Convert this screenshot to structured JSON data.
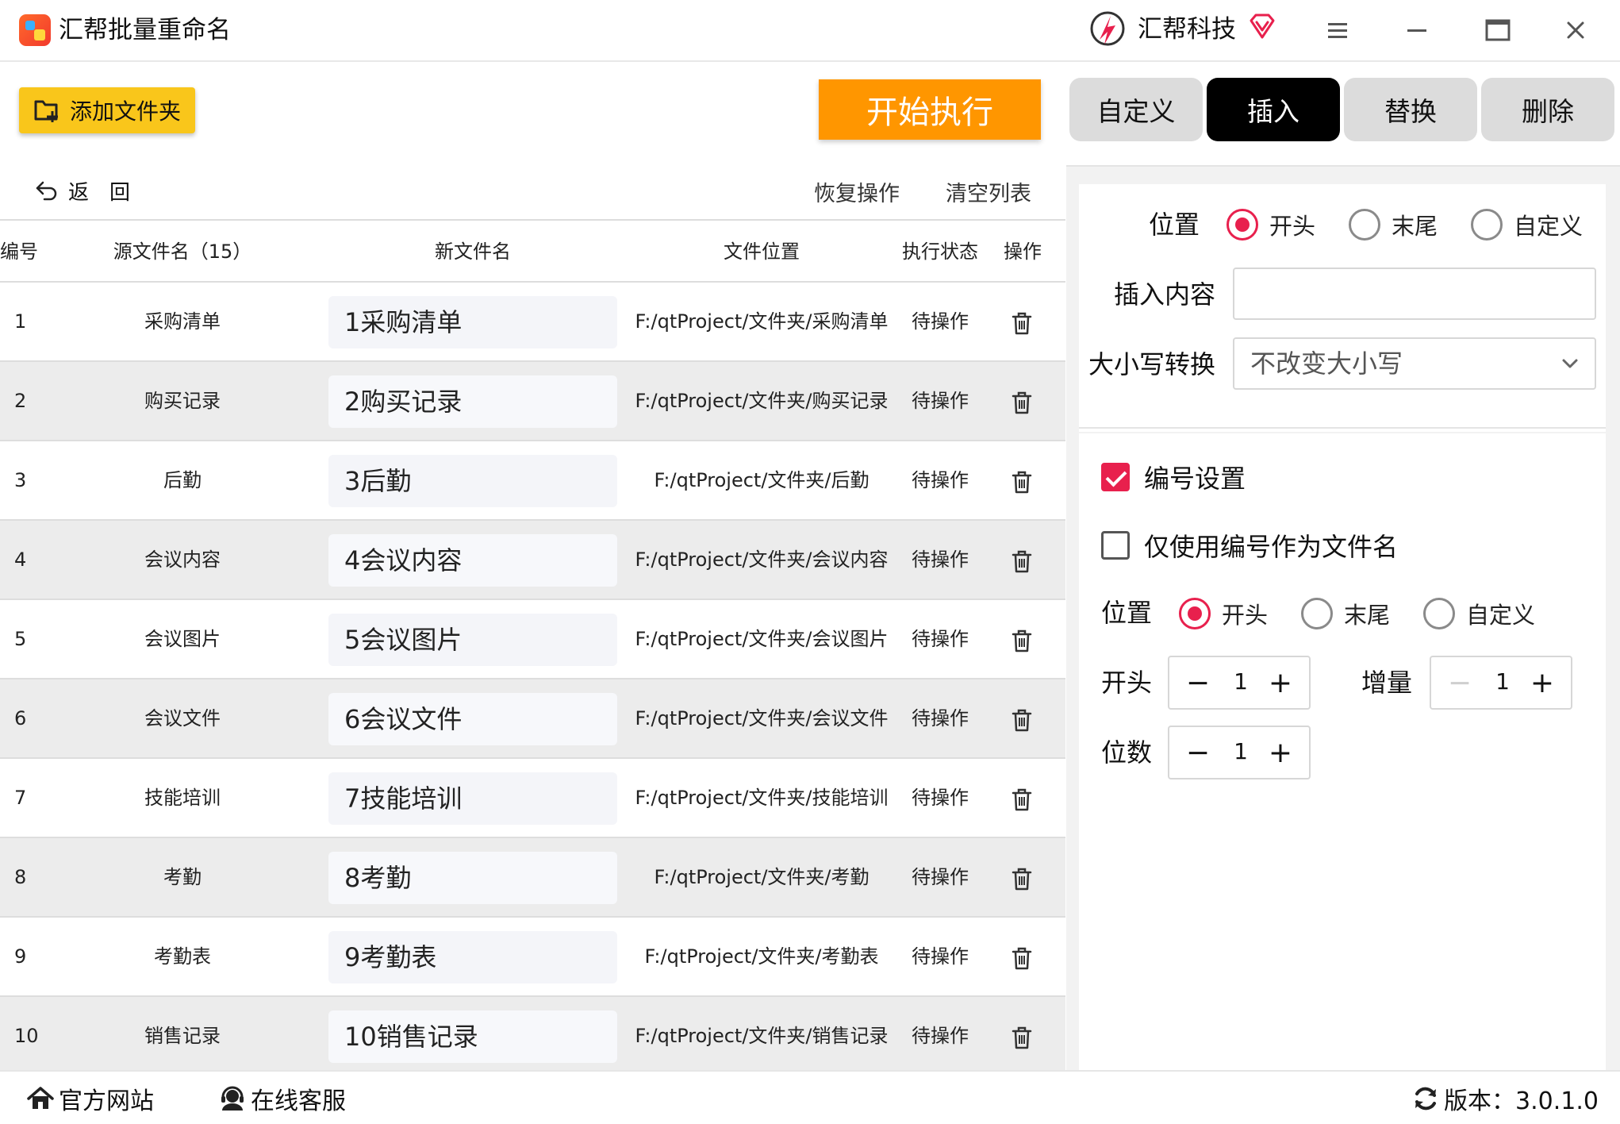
{
  "app": {
    "title": "汇帮批量重命名",
    "brand": "汇帮科技"
  },
  "toolbar": {
    "add_folder": "添加文件夹",
    "start": "开始执行",
    "tabs": [
      "自定义",
      "插入",
      "替换",
      "删除"
    ],
    "active_tab": "插入"
  },
  "list": {
    "back": "返回",
    "restore": "恢复操作",
    "clear": "清空列表",
    "columns": {
      "no": "编号",
      "src": "源文件名（15）",
      "new": "新文件名",
      "loc": "文件位置",
      "status": "执行状态",
      "op": "操作"
    },
    "rows": [
      {
        "no": "1",
        "src": "采购清单",
        "new": "1采购清单",
        "loc": "F:/qtProject/文件夹/采购清单",
        "status": "待操作"
      },
      {
        "no": "2",
        "src": "购买记录",
        "new": "2购买记录",
        "loc": "F:/qtProject/文件夹/购买记录",
        "status": "待操作"
      },
      {
        "no": "3",
        "src": "后勤",
        "new": "3后勤",
        "loc": "F:/qtProject/文件夹/后勤",
        "status": "待操作"
      },
      {
        "no": "4",
        "src": "会议内容",
        "new": "4会议内容",
        "loc": "F:/qtProject/文件夹/会议内容",
        "status": "待操作"
      },
      {
        "no": "5",
        "src": "会议图片",
        "new": "5会议图片",
        "loc": "F:/qtProject/文件夹/会议图片",
        "status": "待操作"
      },
      {
        "no": "6",
        "src": "会议文件",
        "new": "6会议文件",
        "loc": "F:/qtProject/文件夹/会议文件",
        "status": "待操作"
      },
      {
        "no": "7",
        "src": "技能培训",
        "new": "7技能培训",
        "loc": "F:/qtProject/文件夹/技能培训",
        "status": "待操作"
      },
      {
        "no": "8",
        "src": "考勤",
        "new": "8考勤",
        "loc": "F:/qtProject/文件夹/考勤",
        "status": "待操作"
      },
      {
        "no": "9",
        "src": "考勤表",
        "new": "9考勤表",
        "loc": "F:/qtProject/文件夹/考勤表",
        "status": "待操作"
      },
      {
        "no": "10",
        "src": "销售记录",
        "new": "10销售记录",
        "loc": "F:/qtProject/文件夹/销售记录",
        "status": "待操作"
      }
    ]
  },
  "insert": {
    "position_label": "位置",
    "position_options": [
      "开头",
      "末尾",
      "自定义"
    ],
    "position_selected": "开头",
    "content_label": "插入内容",
    "content_value": "",
    "case_label": "大小写转换",
    "case_value": "不改变大小写"
  },
  "numbering": {
    "enable_label": "编号设置",
    "enabled": true,
    "only_number_label": "仅使用编号作为文件名",
    "only_number": false,
    "position_label": "位置",
    "position_options": [
      "开头",
      "末尾",
      "自定义"
    ],
    "position_selected": "开头",
    "start_label": "开头",
    "start_value": "1",
    "step_label": "增量",
    "step_value": "1",
    "digits_label": "位数",
    "digits_value": "1"
  },
  "footer": {
    "website": "官方网站",
    "service": "在线客服",
    "version": "版本：3.0.1.0"
  },
  "colors": {
    "accent": "#e8204d",
    "start_button": "#ff9600",
    "add_button": "#f9c61b"
  },
  "icons": {
    "back": "back-arrow-icon",
    "delete": "trash-icon",
    "home": "home-icon",
    "service": "headset-icon",
    "refresh": "refresh-icon"
  }
}
